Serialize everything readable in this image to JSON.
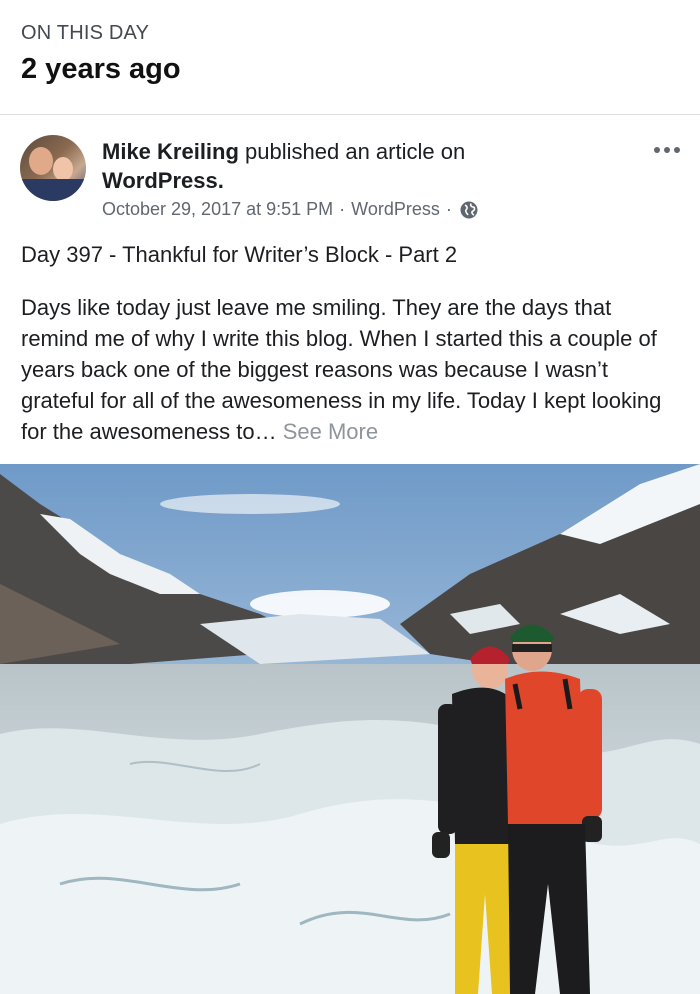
{
  "memory": {
    "eyebrow": "ON THIS DAY",
    "headline": "2 years ago"
  },
  "post": {
    "author": "Mike Kreiling",
    "action": "published an article on",
    "app": "WordPress.",
    "timestamp": "October 29, 2017 at 9:51 PM",
    "source": "WordPress",
    "privacy_icon": "globe-icon",
    "more_icon": "more-options-icon",
    "title": "Day 397 - Thankful for Writer’s Block - Part 2",
    "body": "Days like today just leave me smiling. They are the days that remind me of why I write this blog. When I started this a couple of years back one of the biggest reasons was because I wasn’t grateful for all of the awesomeness in my life. Today I kept looking for the awesomeness to…",
    "see_more": "See More"
  },
  "colors": {
    "text": "#1c1e21",
    "secondary": "#606770",
    "link_gray": "#90949c"
  }
}
